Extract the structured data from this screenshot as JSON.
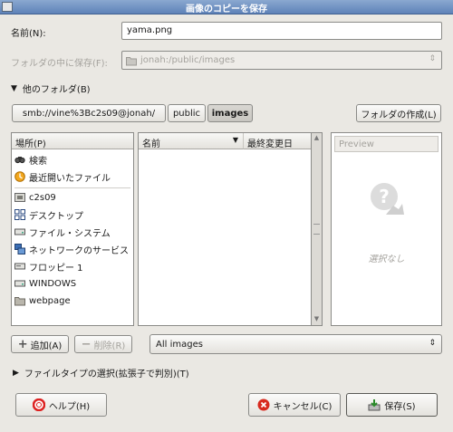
{
  "window": {
    "title": "画像のコピーを保存"
  },
  "name_label": "名前(N):",
  "name_value": "yama.png",
  "save_in_label": "フォルダの中に保存(F):",
  "save_in_value": "jonah:/public/images",
  "other_folders_label": "他のフォルダ(B)",
  "path": [
    "smb://vine%3Bc2s09@jonah/",
    "public",
    "images"
  ],
  "create_folder_label": "フォルダの作成(L)",
  "places": {
    "header": "場所(P)",
    "items": [
      {
        "label": "検索",
        "icon": "search-icon"
      },
      {
        "label": "最近開いたファイル",
        "icon": "recent-icon"
      },
      {
        "label": "c2s09",
        "icon": "home-folder-icon"
      },
      {
        "label": "デスクトップ",
        "icon": "desktop-icon"
      },
      {
        "label": "ファイル・システム",
        "icon": "drive-icon"
      },
      {
        "label": "ネットワークのサービス",
        "icon": "network-icon"
      },
      {
        "label": "フロッピー 1",
        "icon": "floppy-icon"
      },
      {
        "label": "WINDOWS",
        "icon": "drive-icon"
      },
      {
        "label": "webpage",
        "icon": "folder-icon"
      }
    ]
  },
  "files": {
    "col_name": "名前",
    "col_modified": "最終変更日"
  },
  "preview": {
    "header": "Preview",
    "no_selection": "選択なし"
  },
  "add_label": "追加(A)",
  "remove_label": "削除(R)",
  "filter_value": "All images",
  "file_type_label": "ファイルタイプの選択(拡張子で判別)(T)",
  "help_label": "ヘルプ(H)",
  "cancel_label": "キャンセル(C)",
  "save_label": "保存(S)"
}
